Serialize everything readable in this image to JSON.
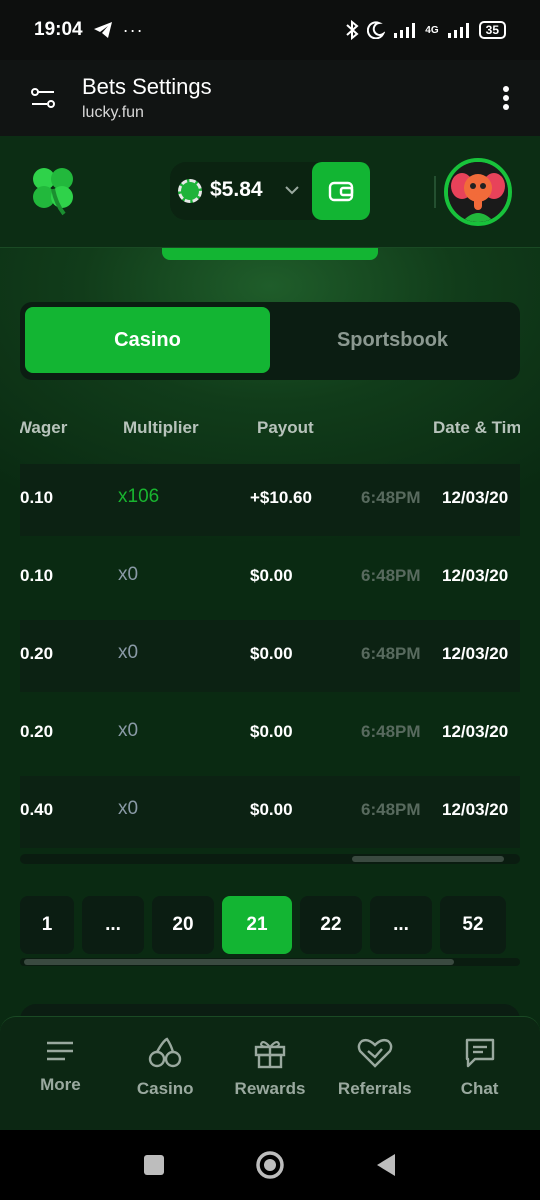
{
  "status_bar": {
    "time": "19:04",
    "network": "4G",
    "battery": "35"
  },
  "header": {
    "title": "Bets Settings",
    "url": "lucky.fun"
  },
  "topbar": {
    "balance": "$5.84"
  },
  "tabs": [
    {
      "label": "Casino",
      "active": true
    },
    {
      "label": "Sportsbook",
      "active": false
    }
  ],
  "table": {
    "columns": [
      "Wager",
      "Multiplier",
      "Payout",
      "Date & Time"
    ],
    "rows": [
      {
        "wager": "0.10",
        "multiplier": "x106",
        "payout": "+$10.60",
        "time": "6:48PM",
        "date": "12/03/20"
      },
      {
        "wager": "0.10",
        "multiplier": "x0",
        "payout": "$0.00",
        "time": "6:48PM",
        "date": "12/03/20"
      },
      {
        "wager": "0.20",
        "multiplier": "x0",
        "payout": "$0.00",
        "time": "6:48PM",
        "date": "12/03/20"
      },
      {
        "wager": "0.20",
        "multiplier": "x0",
        "payout": "$0.00",
        "time": "6:48PM",
        "date": "12/03/20"
      },
      {
        "wager": "0.40",
        "multiplier": "x0",
        "payout": "$0.00",
        "time": "6:48PM",
        "date": "12/03/20"
      }
    ]
  },
  "pagination": {
    "pages": [
      "1",
      "...",
      "20",
      "21",
      "22",
      "...",
      "52"
    ],
    "current": "21"
  },
  "bottom_nav": [
    {
      "label": "More",
      "icon": "menu-icon"
    },
    {
      "label": "Casino",
      "icon": "cherries-icon"
    },
    {
      "label": "Rewards",
      "icon": "gift-icon"
    },
    {
      "label": "Referrals",
      "icon": "handshake-icon"
    },
    {
      "label": "Chat",
      "icon": "chat-icon"
    }
  ],
  "colors": {
    "accent": "#13b533",
    "win_multiplier": "#18b52f",
    "loss_multiplier": "#8a9aa6"
  }
}
